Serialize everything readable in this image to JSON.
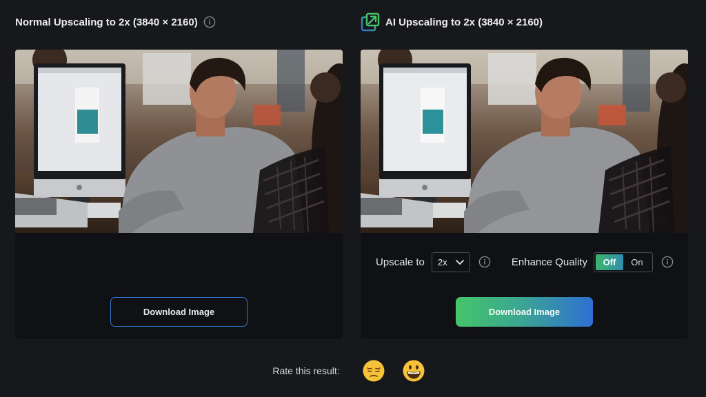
{
  "left_panel": {
    "title": "Normal Upscaling to 2x (3840 × 2160)",
    "info_icon": "info-icon",
    "download_label": "Download Image"
  },
  "right_panel": {
    "title": "AI Upscaling to 2x (3840 × 2160)",
    "logo_icon": "ai-upscale-logo-icon",
    "upscale_label": "Upscale to",
    "upscale_value": "2x",
    "enhance_label": "Enhance Quality",
    "toggle_off_label": "Off",
    "toggle_on_label": "On",
    "toggle_selected": "Off",
    "download_label": "Download Image"
  },
  "rating": {
    "label": "Rate this result:",
    "options": [
      "pensive-face-emoji",
      "grinning-face-emoji"
    ]
  },
  "colors": {
    "background": "#17181b",
    "card": "#101114",
    "outline_button_border": "#2f78d4",
    "gradient_start": "#45c46b",
    "gradient_end": "#2f6fd2"
  }
}
